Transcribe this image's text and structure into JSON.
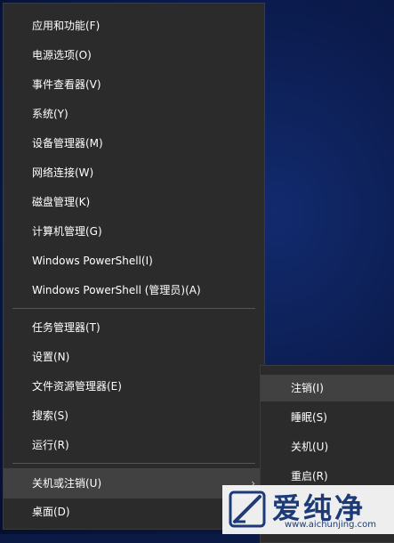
{
  "menu": {
    "items": [
      {
        "label": "应用和功能(F)"
      },
      {
        "label": "电源选项(O)"
      },
      {
        "label": "事件查看器(V)"
      },
      {
        "label": "系统(Y)"
      },
      {
        "label": "设备管理器(M)"
      },
      {
        "label": "网络连接(W)"
      },
      {
        "label": "磁盘管理(K)"
      },
      {
        "label": "计算机管理(G)"
      },
      {
        "label": "Windows PowerShell(I)"
      },
      {
        "label": "Windows PowerShell (管理员)(A)"
      },
      {
        "label": "任务管理器(T)"
      },
      {
        "label": "设置(N)"
      },
      {
        "label": "文件资源管理器(E)"
      },
      {
        "label": "搜索(S)"
      },
      {
        "label": "运行(R)"
      },
      {
        "label": "关机或注销(U)"
      },
      {
        "label": "桌面(D)"
      }
    ],
    "submenu_arrow": "›"
  },
  "submenu": {
    "items": [
      {
        "label": "注销(I)"
      },
      {
        "label": "睡眠(S)"
      },
      {
        "label": "关机(U)"
      },
      {
        "label": "重启(R)"
      }
    ]
  },
  "watermark": {
    "title": "爱纯净",
    "url": "www.aichunjing.com"
  },
  "colors": {
    "menu_bg": "#2b2b2b",
    "highlight": "#414141",
    "text": "#ffffff",
    "desktop": "#0b1b4d"
  }
}
